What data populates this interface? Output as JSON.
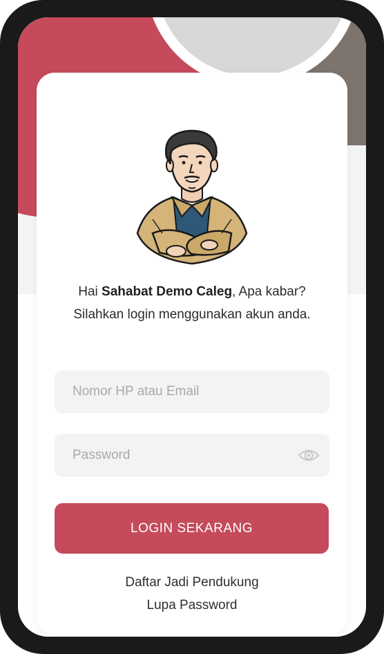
{
  "greeting": {
    "prefix": "Hai ",
    "name": "Sahabat Demo Caleg",
    "suffix": ", Apa kabar? Silahkan login menggunakan akun anda."
  },
  "form": {
    "email_placeholder": "Nomor HP atau Email",
    "email_value": "",
    "password_placeholder": "Password",
    "password_value": "",
    "login_label": "LOGIN SEKARANG"
  },
  "links": {
    "register": "Daftar Jadi Pendukung",
    "forgot": "Lupa Password"
  },
  "icons": {
    "password_toggle": "eye-icon",
    "avatar": "avatar-illustration"
  },
  "colors": {
    "accent": "#c54a5b",
    "secondary": "#7d746e",
    "frame": "#1a1a1a"
  }
}
